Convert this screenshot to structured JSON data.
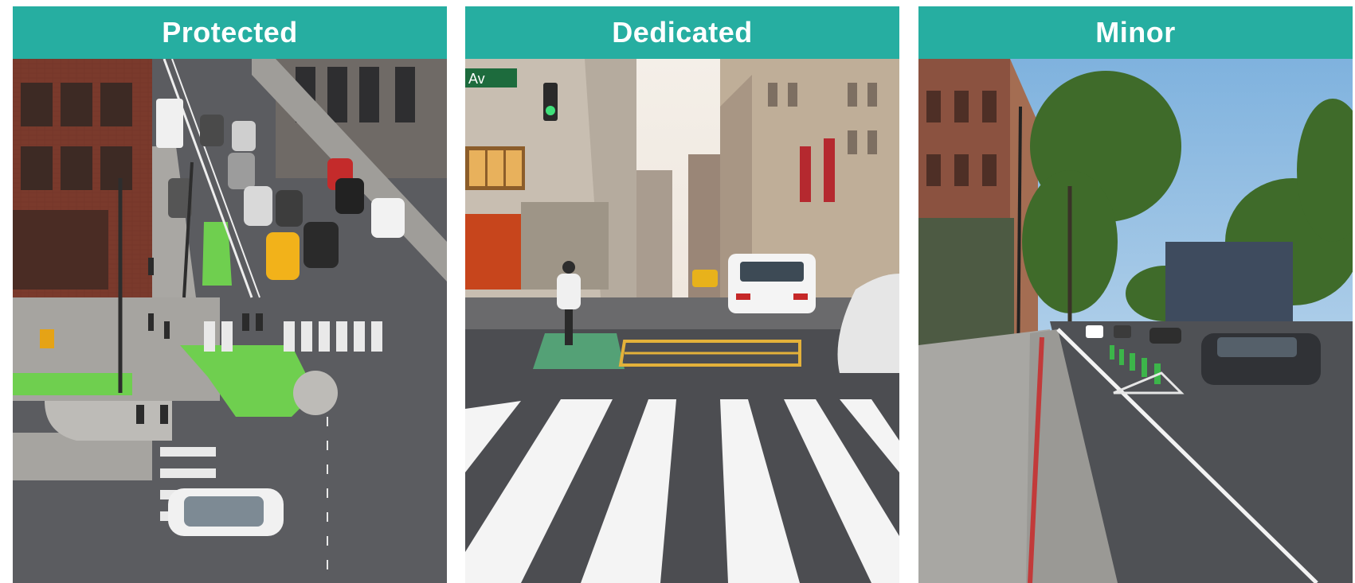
{
  "panels": [
    {
      "title": "Protected",
      "photo": "Overhead view of an intersection with a green-painted protected bike lane and corner islands"
    },
    {
      "title": "Dedicated",
      "photo": "Street-level view of a cyclist riding in a green dedicated bike lane between tall buildings"
    },
    {
      "title": "Minor",
      "photo": "Street with a painted bike lane separated by green flexible delineator posts, trees and sidewalk"
    }
  ],
  "street_sign": "Av",
  "colors": {
    "header": "#26aea1",
    "bike_lane_green": "#6fcf4f",
    "asphalt": "#55565a"
  }
}
